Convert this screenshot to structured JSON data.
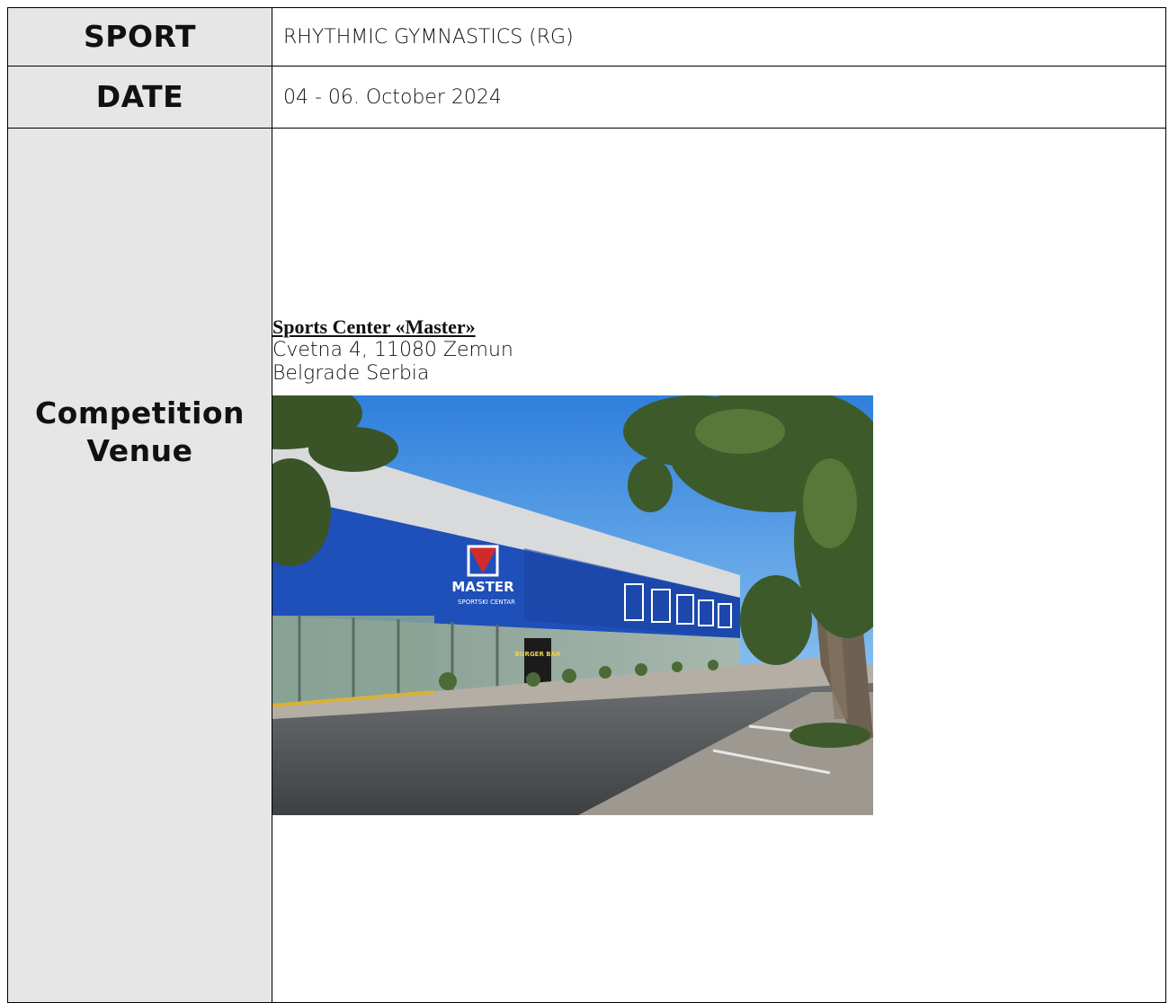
{
  "rows": {
    "sport": {
      "label": "SPORT",
      "value": "RHYTHMIC GYMNASTICS (RG)"
    },
    "date": {
      "label": "DATE",
      "value": "04 - 06. October 2024"
    },
    "venue": {
      "label_line1": "Competition",
      "label_line2": "Venue",
      "name": "Sports Center «Master»",
      "address_line1": "Cvetna 4, 11080 Zemun",
      "address_line2": "Belgrade  Serbia",
      "photo": {
        "sign_main": "MASTER",
        "sign_sub": "SPORTSKI CENTAR",
        "kiosk": "BURGER BAR"
      }
    }
  },
  "colors": {
    "label_bg": "#e6e6e6",
    "facade_blue": "#1f4fb8",
    "sky_blue": "#3e8ee6",
    "foliage": "#3d5a2a"
  }
}
